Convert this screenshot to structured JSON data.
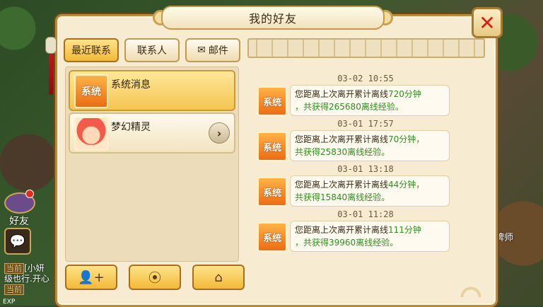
{
  "title": "我的好友",
  "close_symbol": "✕",
  "tabs": [
    {
      "label": "最近联系",
      "active": true
    },
    {
      "label": "联系人",
      "active": false
    },
    {
      "label": "邮件",
      "active": false,
      "icon": "mail-icon"
    }
  ],
  "contacts": [
    {
      "badge": "系统",
      "name": "系统消息",
      "selected": true
    },
    {
      "name": "梦幻精灵",
      "avatar": "fairy-avatar",
      "arrow": "›"
    }
  ],
  "bottom_buttons": [
    {
      "icon": "add-friend-icon",
      "glyph": "👤+"
    },
    {
      "icon": "location-icon",
      "glyph": "⦿"
    },
    {
      "icon": "home-icon",
      "glyph": "⌂"
    }
  ],
  "messages": [
    {
      "time": "03-02  10:55",
      "badge": "系统",
      "prefix": "您距离上次离开累计离线",
      "minutes": "720分钟",
      "line2_a": "，共获得",
      "exp": "265680离线经验。"
    },
    {
      "time": "03-01  17:57",
      "badge": "系统",
      "prefix": "您距离上次离开累计离线",
      "minutes": "70分钟，",
      "line2_a": "共获得",
      "exp": "25830离线经验。"
    },
    {
      "time": "03-01  13:18",
      "badge": "系统",
      "prefix": "您距离上次离开累计离线",
      "minutes": "44分钟，",
      "line2_a": "共获得",
      "exp": "15840离线经验。"
    },
    {
      "time": "03-01  11:28",
      "badge": "系统",
      "prefix": "您距离上次离开累计离线",
      "minutes": "111分钟",
      "line2_a": "，共获得",
      "exp": "39960离线经验。"
    }
  ],
  "hud": {
    "friend_label": "好友",
    "chat_tag": "当前",
    "chat_line1": "[小妍",
    "chat_line2": "级也行.开心",
    "chat_tag2": "当前",
    "exp_label": "EXP",
    "right_text": "牌师"
  },
  "colors": {
    "accent_gold": "#f2b938",
    "exp_green": "#2e8f1c",
    "close_red": "#d81e14"
  }
}
